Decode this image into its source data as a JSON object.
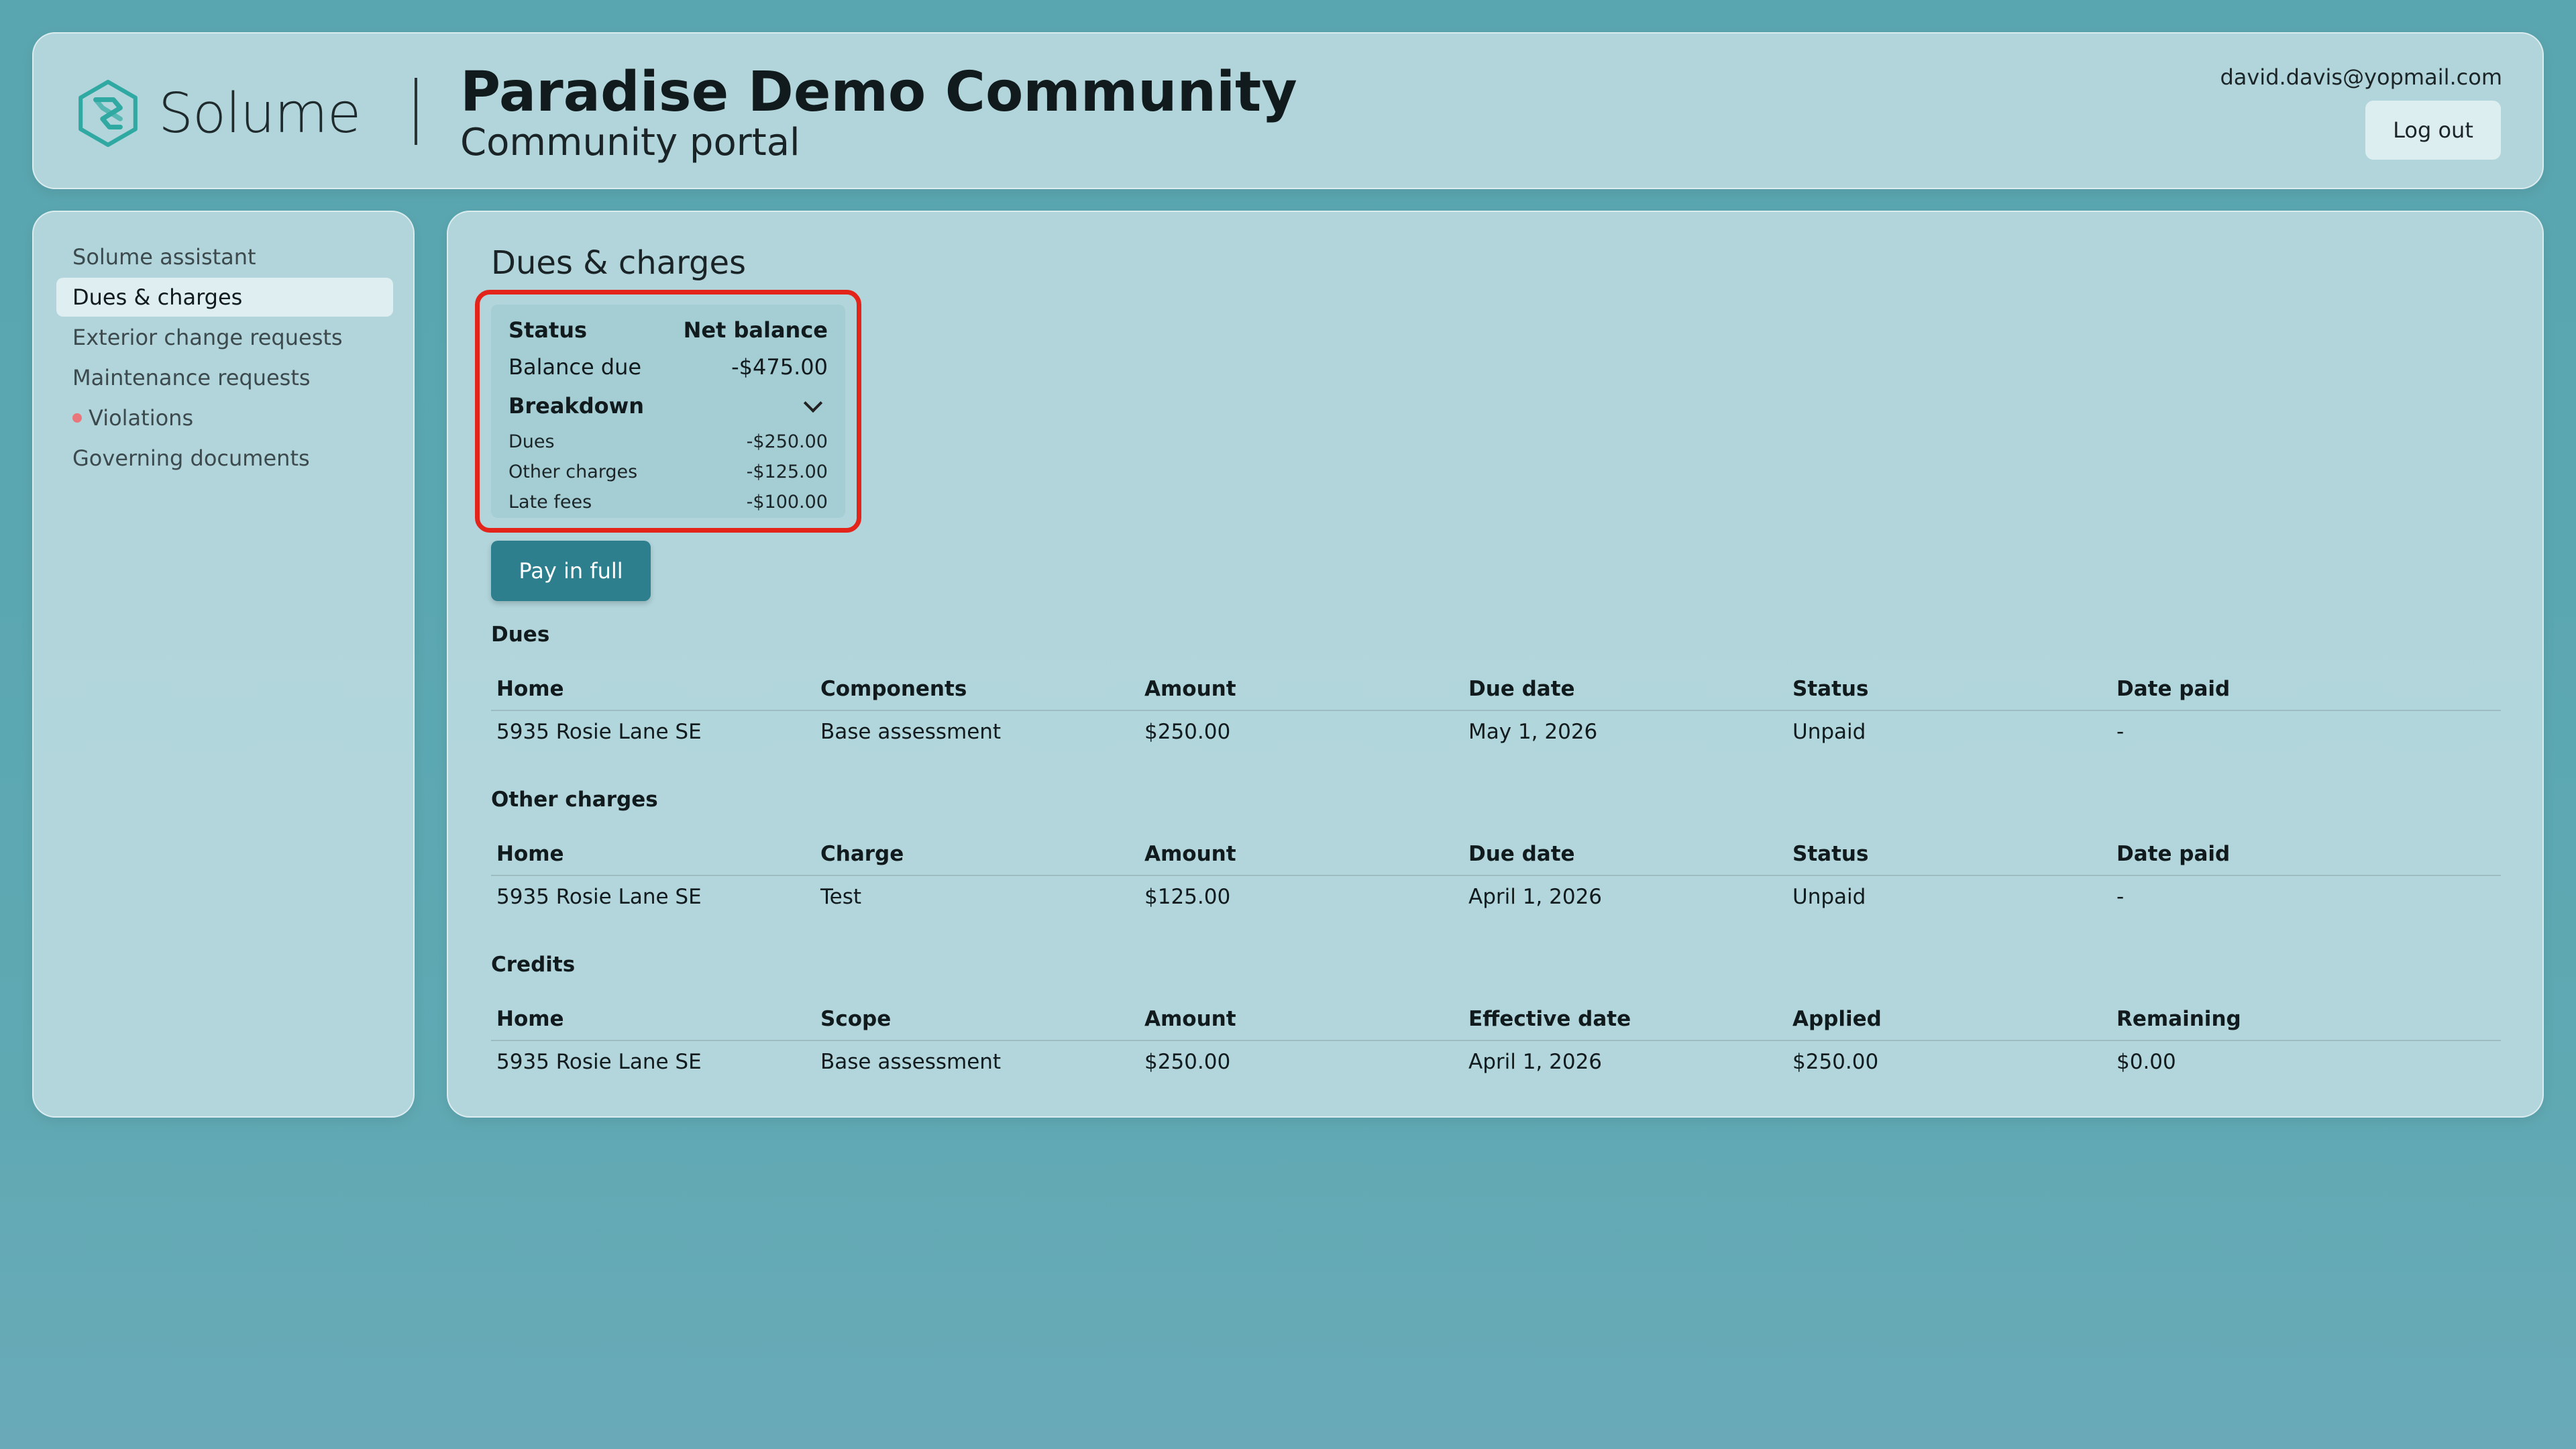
{
  "header": {
    "brand": "Solume",
    "community_name": "Paradise Demo Community",
    "portal_label": "Community portal",
    "user_email": "david.davis@yopmail.com",
    "logout_label": "Log out",
    "logo_icon": "solume-logo-icon",
    "accent_color": "#2fa9a2"
  },
  "sidebar": {
    "items": [
      {
        "label": "Solume assistant"
      },
      {
        "label": "Dues & charges",
        "active": true
      },
      {
        "label": "Exterior change requests"
      },
      {
        "label": "Maintenance requests"
      },
      {
        "label": "Violations",
        "alert": true
      },
      {
        "label": "Governing documents"
      }
    ],
    "alert_color": "#e9767a"
  },
  "main": {
    "title": "Dues & charges",
    "summary": {
      "status_label": "Status",
      "status_value": "Net balance",
      "balance_label": "Balance due",
      "balance_value": "-$475.00",
      "breakdown_label": "Breakdown",
      "breakdown": [
        {
          "label": "Dues",
          "value": "-$250.00"
        },
        {
          "label": "Other charges",
          "value": "-$125.00"
        },
        {
          "label": "Late fees",
          "value": "-$100.00"
        }
      ],
      "highlight_color": "#e3241b"
    },
    "pay_label": "Pay in full",
    "pay_color": "#2d7f8e",
    "dues": {
      "title": "Dues",
      "headers": [
        "Home",
        "Components",
        "Amount",
        "Due date",
        "Status",
        "Date paid"
      ],
      "rows": [
        [
          "5935 Rosie Lane SE",
          "Base assessment",
          "$250.00",
          "May 1, 2026",
          "Unpaid",
          "-"
        ]
      ]
    },
    "other_charges": {
      "title": "Other charges",
      "headers": [
        "Home",
        "Charge",
        "Amount",
        "Due date",
        "Status",
        "Date paid"
      ],
      "rows": [
        [
          "5935 Rosie Lane SE",
          "Test",
          "$125.00",
          "April 1, 2026",
          "Unpaid",
          "-"
        ]
      ]
    },
    "credits": {
      "title": "Credits",
      "headers": [
        "Home",
        "Scope",
        "Amount",
        "Effective date",
        "Applied",
        "Remaining"
      ],
      "rows": [
        [
          "5935 Rosie Lane SE",
          "Base assessment",
          "$250.00",
          "April 1, 2026",
          "$250.00",
          "$0.00"
        ]
      ]
    }
  }
}
